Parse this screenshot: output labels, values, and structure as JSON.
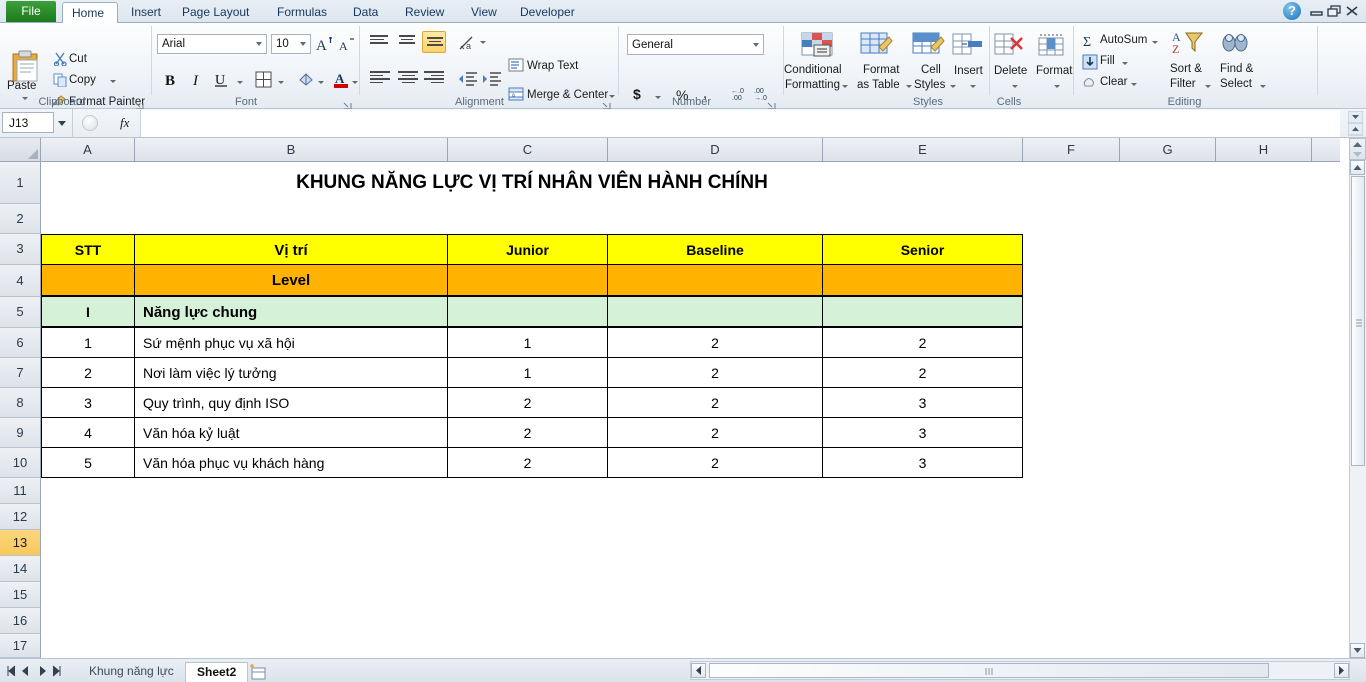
{
  "window": {
    "quick_access": [
      "save-icon",
      "undo-icon",
      "redo-icon"
    ],
    "help": "?",
    "minimize": "minimize-icon",
    "restore": "restore-icon",
    "close": "close-icon"
  },
  "ribbon": {
    "file_tab": "File",
    "tabs": [
      {
        "label": "Home",
        "active": true
      },
      {
        "label": "Insert",
        "active": false
      },
      {
        "label": "Page Layout",
        "active": false
      },
      {
        "label": "Formulas",
        "active": false
      },
      {
        "label": "Data",
        "active": false
      },
      {
        "label": "Review",
        "active": false
      },
      {
        "label": "View",
        "active": false
      },
      {
        "label": "Developer",
        "active": false
      }
    ],
    "groups": {
      "clipboard": {
        "label": "Clipboard",
        "paste": "Paste",
        "cut": "Cut",
        "copy": "Copy",
        "format_painter": "Format Painter"
      },
      "font": {
        "label": "Font",
        "font_name": "Arial",
        "font_size": "10",
        "grow_font": "A",
        "shrink_font": "A",
        "bold": "B",
        "italic": "I",
        "underline": "U"
      },
      "alignment": {
        "label": "Alignment",
        "wrap_text": "Wrap Text",
        "merge_center": "Merge & Center"
      },
      "number": {
        "label": "Number",
        "format": "General",
        "currency": "$",
        "percent": "%",
        "comma": ","
      },
      "styles": {
        "label": "Styles",
        "conditional_formatting": "Conditional\nFormatting",
        "conditional_formatting_l1": "Conditional",
        "conditional_formatting_l2": "Formatting",
        "format_as_table_l1": "Format",
        "format_as_table_l2": "as Table",
        "cell_styles_l1": "Cell",
        "cell_styles_l2": "Styles"
      },
      "cells": {
        "label": "Cells",
        "insert": "Insert",
        "delete": "Delete",
        "format": "Format"
      },
      "editing": {
        "label": "Editing",
        "autosum": "AutoSum",
        "fill": "Fill",
        "clear": "Clear",
        "sort_filter_l1": "Sort &",
        "sort_filter_l2": "Filter",
        "find_select_l1": "Find &",
        "find_select_l2": "Select"
      }
    }
  },
  "formula_bar": {
    "name_box": "J13",
    "fx_label": "fx",
    "formula_value": ""
  },
  "grid": {
    "columns": [
      "A",
      "B",
      "C",
      "D",
      "E",
      "F",
      "G",
      "H"
    ],
    "rows": [
      "1",
      "2",
      "3",
      "4",
      "5",
      "6",
      "7",
      "8",
      "9",
      "10",
      "11",
      "12",
      "13",
      "14",
      "15",
      "16",
      "17"
    ],
    "selected_row": "13",
    "selected_cell": "J13"
  },
  "sheet": {
    "title": "KHUNG NĂNG LỰC VỊ TRÍ NHÂN VIÊN HÀNH CHÍNH",
    "table": {
      "header": [
        "STT",
        "Vị trí",
        "Junior",
        "Baseline",
        "Senior"
      ],
      "level_row": [
        "",
        "Level",
        "",
        "",
        ""
      ],
      "section_row": [
        "I",
        "Năng lực chung",
        "",
        "",
        ""
      ],
      "rows": [
        [
          "1",
          "Sứ mệnh phục vụ xã hội",
          "1",
          "2",
          "2"
        ],
        [
          "2",
          "Nơi làm việc lý tưởng",
          "1",
          "2",
          "2"
        ],
        [
          "3",
          "Quy trình, quy định ISO",
          "2",
          "2",
          "3"
        ],
        [
          "4",
          "Văn hóa kỷ luật",
          "2",
          "2",
          "3"
        ],
        [
          "5",
          "Văn hóa phục vụ khách hàng",
          "2",
          "2",
          "3"
        ]
      ]
    },
    "colors": {
      "header_fill": "#FFFF00",
      "level_fill": "#FFB300",
      "section_fill": "#D5F2D8",
      "selected_row_fill": "#FCD77F"
    }
  },
  "sheet_tabs": {
    "tabs": [
      {
        "label": "Khung năng lực",
        "active": false
      },
      {
        "label": "Sheet2",
        "active": true
      }
    ],
    "new_sheet": "new-sheet-icon",
    "nav_first": "first-sheet-icon",
    "nav_prev": "prev-sheet-icon",
    "nav_next": "next-sheet-icon",
    "nav_last": "last-sheet-icon"
  }
}
